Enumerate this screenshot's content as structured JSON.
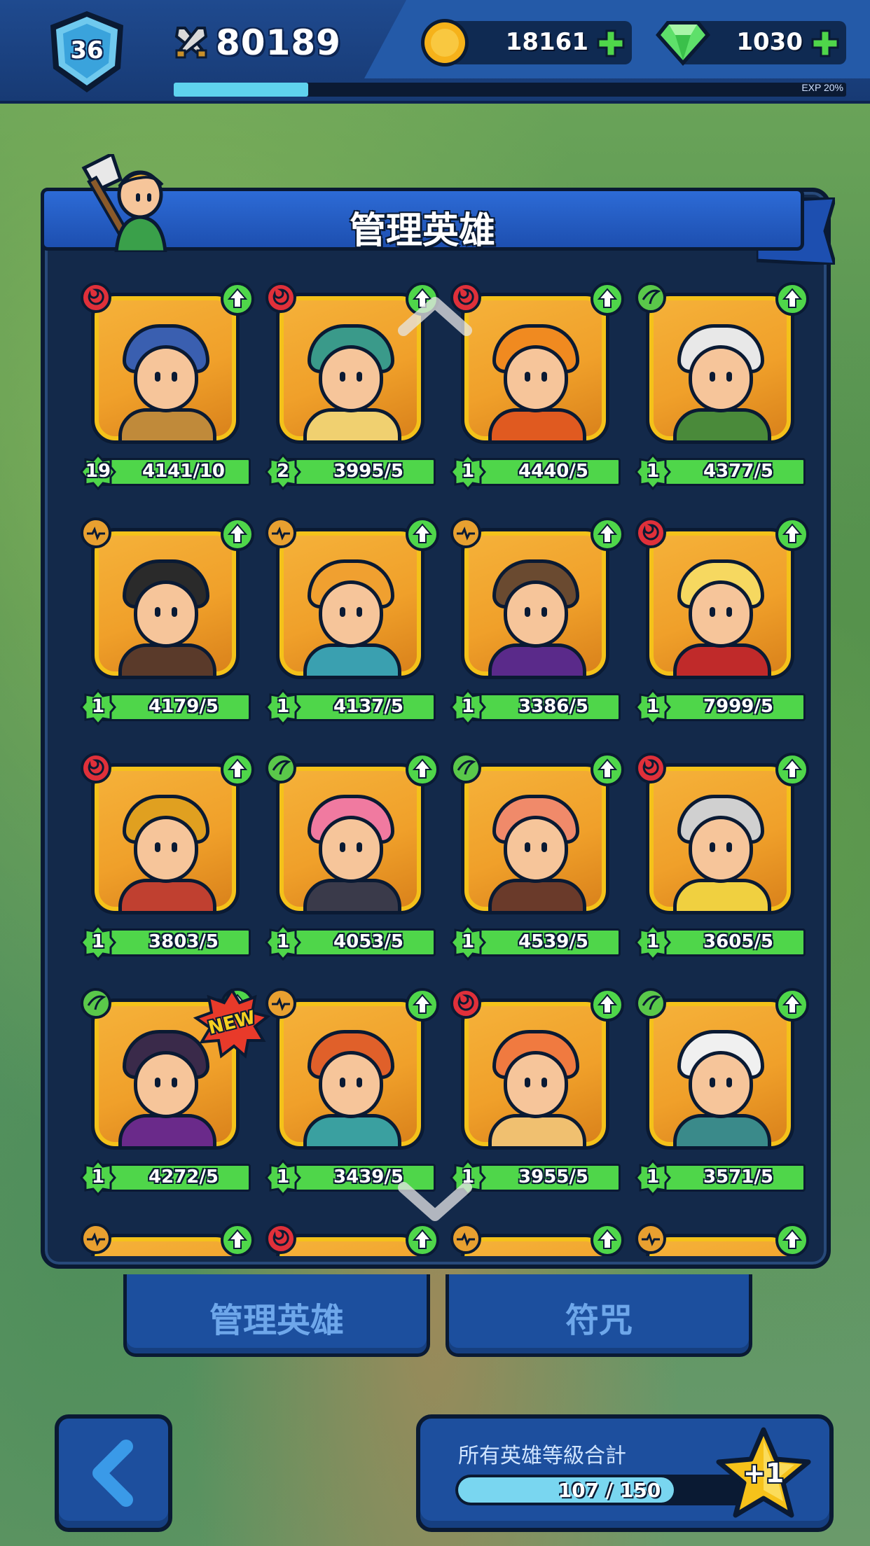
{
  "header": {
    "level": "36",
    "power": "80189",
    "exp_label": "EXP 20%",
    "exp_progress": 0.2,
    "coins": "18161",
    "gems": "1030"
  },
  "panel": {
    "title": "管理英雄"
  },
  "heroes": [
    {
      "element": "fire",
      "level": "19",
      "power": "4141/10",
      "portrait": "knight-hero",
      "hair": "#3a5fb0",
      "body": "#c08a3a"
    },
    {
      "element": "fire",
      "level": "2",
      "power": "3995/5",
      "portrait": "jade-dancer-hero",
      "hair": "#3a9a8a",
      "body": "#f0d070"
    },
    {
      "element": "fire",
      "level": "1",
      "power": "4440/5",
      "portrait": "orange-hooded-hero",
      "hair": "#f08a20",
      "body": "#e05a20"
    },
    {
      "element": "wind",
      "level": "1",
      "power": "4377/5",
      "portrait": "horned-goblin-hero",
      "hair": "#e8e8e8",
      "body": "#4a8a3a"
    },
    {
      "element": "light",
      "level": "1",
      "power": "4179/5",
      "portrait": "pirate-captain-hero",
      "hair": "#2a2a2a",
      "body": "#5a3a2a"
    },
    {
      "element": "light",
      "level": "1",
      "power": "4137/5",
      "portrait": "ice-priestess-hero",
      "hair": "#f0a030",
      "body": "#3aa0b0"
    },
    {
      "element": "light",
      "level": "1",
      "power": "3386/5",
      "portrait": "helmet-mage-hero",
      "hair": "#6a4a30",
      "body": "#5a2a8a"
    },
    {
      "element": "fire",
      "level": "1",
      "power": "7999/5",
      "portrait": "princess-hero",
      "hair": "#f6d860",
      "body": "#c02a2a"
    },
    {
      "element": "fire",
      "level": "1",
      "power": "3803/5",
      "portrait": "golden-knight-hero",
      "hair": "#e0a020",
      "body": "#c04030"
    },
    {
      "element": "wind",
      "level": "1",
      "power": "4053/5",
      "portrait": "pink-reaper-hero",
      "hair": "#f07aa0",
      "body": "#3a3a4a"
    },
    {
      "element": "wind",
      "level": "1",
      "power": "4539/5",
      "portrait": "ribbon-girl-hero",
      "hair": "#f08a6a",
      "body": "#6a3a2a"
    },
    {
      "element": "fire",
      "level": "1",
      "power": "3605/5",
      "portrait": "paladin-hero",
      "hair": "#d0d0d0",
      "body": "#f0d040"
    },
    {
      "element": "wind",
      "level": "1",
      "power": "4272/5",
      "portrait": "necromancer-hero",
      "hair": "#3a2a4a",
      "body": "#6a2a8a",
      "badge": "NEW"
    },
    {
      "element": "light",
      "level": "1",
      "power": "3439/5",
      "portrait": "flame-queen-hero",
      "hair": "#e0602a",
      "body": "#3aa0a0"
    },
    {
      "element": "fire",
      "level": "1",
      "power": "3955/5",
      "portrait": "bandana-girl-hero",
      "hair": "#f07a40",
      "body": "#f0c070"
    },
    {
      "element": "wind",
      "level": "1",
      "power": "3571/5",
      "portrait": "ice-viking-hero",
      "hair": "#f0f0f0",
      "body": "#3a8a8a"
    },
    {
      "element": "light",
      "level": "",
      "power": "",
      "portrait": "partial-hero",
      "hair": "#e09030",
      "body": "#e09030"
    },
    {
      "element": "fire",
      "level": "",
      "power": "",
      "portrait": "partial-hero",
      "hair": "#e09030",
      "body": "#e09030"
    },
    {
      "element": "light",
      "level": "",
      "power": "",
      "portrait": "partial-hero",
      "hair": "#e09030",
      "body": "#e09030"
    },
    {
      "element": "light",
      "level": "",
      "power": "",
      "portrait": "partial-hero",
      "hair": "#e09030",
      "body": "#e09030"
    }
  ],
  "tabs": [
    {
      "label": "管理英雄"
    },
    {
      "label": "符咒"
    }
  ],
  "footer": {
    "total_label": "所有英雄等級合計",
    "total_value": "107 / 150",
    "total_current": 107,
    "total_max": 150,
    "star_label": "+1"
  },
  "colors": {
    "fire": "#e0303a",
    "wind": "#5ac84a",
    "light": "#e8a030",
    "card_bg": "#f0a02a",
    "upgrade": "#4fd64a"
  }
}
